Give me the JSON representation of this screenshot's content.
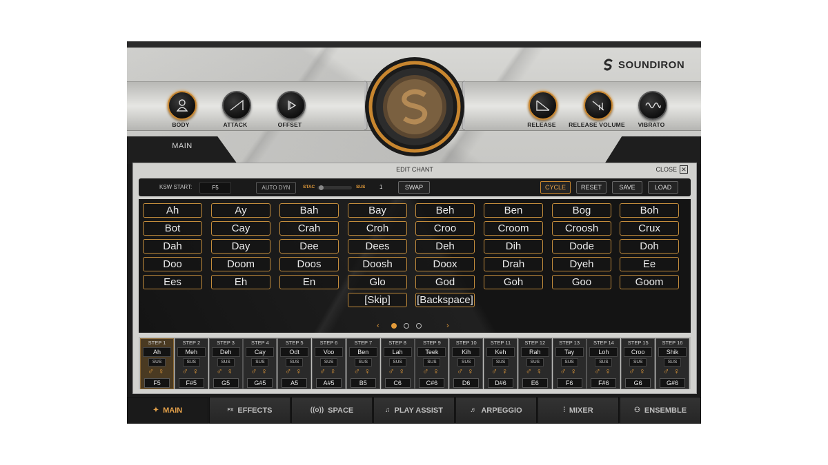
{
  "brand": {
    "name": "SOUNDIRON"
  },
  "knobs": [
    {
      "label": "BODY",
      "icon": "body-icon"
    },
    {
      "label": "ATTACK",
      "icon": "attack-ramp-icon"
    },
    {
      "label": "OFFSET",
      "icon": "offset-icon"
    },
    {
      "label": "RELEASE",
      "icon": "release-ramp-icon"
    },
    {
      "label": "RELEASE VOLUME",
      "icon": "release-volume-icon"
    },
    {
      "label": "VIBRATO",
      "icon": "vibrato-wave-icon"
    }
  ],
  "header": {
    "main_label": "MAIN"
  },
  "edit": {
    "title": "EDIT CHANT",
    "close_label": "CLOSE",
    "ksw_label": "KSW START:",
    "ksw_value": "F5",
    "auto_dyn": "AUTO DYN",
    "stac": "STAC",
    "sus": "SUS",
    "count": "1",
    "swap": "SWAP",
    "cycle": "CYCLE",
    "reset": "RESET",
    "save": "SAVE",
    "load": "LOAD"
  },
  "syllables": [
    [
      "Ah",
      "Ay",
      "Bah",
      "Bay",
      "Beh",
      "Ben",
      "Bog",
      "Boh"
    ],
    [
      "Bot",
      "Cay",
      "Crah",
      "Croh",
      "Croo",
      "Croom",
      "Croosh",
      "Crux"
    ],
    [
      "Dah",
      "Day",
      "Dee",
      "Dees",
      "Deh",
      "Dih",
      "Dode",
      "Doh"
    ],
    [
      "Doo",
      "Doom",
      "Doos",
      "Doosh",
      "Doox",
      "Drah",
      "Dyeh",
      "Ee"
    ],
    [
      "Ees",
      "Eh",
      "En",
      "Glo",
      "God",
      "Goh",
      "Goo",
      "Goom"
    ],
    [
      "",
      "",
      "",
      "[Skip]",
      "[Backspace]",
      "",
      "",
      ""
    ]
  ],
  "pager": {
    "prev": "‹",
    "next": "›",
    "pages": 3,
    "current": 1
  },
  "steps": [
    {
      "name": "STEP 1",
      "syl": "Ah",
      "sus": "SUS",
      "note": "F5"
    },
    {
      "name": "STEP 2",
      "syl": "Meh",
      "sus": "SUS",
      "note": "F#5"
    },
    {
      "name": "STEP 3",
      "syl": "Deh",
      "sus": "SUS",
      "note": "G5"
    },
    {
      "name": "STEP 4",
      "syl": "Cay",
      "sus": "SUS",
      "note": "G#5"
    },
    {
      "name": "STEP 5",
      "syl": "Odt",
      "sus": "SUS",
      "note": "A5"
    },
    {
      "name": "STEP 6",
      "syl": "Voo",
      "sus": "SUS",
      "note": "A#5"
    },
    {
      "name": "STEP 7",
      "syl": "Ben",
      "sus": "SUS",
      "note": "B5"
    },
    {
      "name": "STEP 8",
      "syl": "Lah",
      "sus": "SUS",
      "note": "C6"
    },
    {
      "name": "STEP 9",
      "syl": "Teek",
      "sus": "SUS",
      "note": "C#6"
    },
    {
      "name": "STEP 10",
      "syl": "Kih",
      "sus": "SUS",
      "note": "D6"
    },
    {
      "name": "STEP 11",
      "syl": "Keh",
      "sus": "SUS",
      "note": "D#6"
    },
    {
      "name": "STEP 12",
      "syl": "Rah",
      "sus": "SUS",
      "note": "E6"
    },
    {
      "name": "STEP 13",
      "syl": "Tay",
      "sus": "SUS",
      "note": "F6"
    },
    {
      "name": "STEP 14",
      "syl": "Loh",
      "sus": "SUS",
      "note": "F#6"
    },
    {
      "name": "STEP 15",
      "syl": "Croo",
      "sus": "SUS",
      "note": "G6"
    },
    {
      "name": "STEP 16",
      "syl": "Shik",
      "sus": "SUS",
      "note": "G#6"
    }
  ],
  "tabs": [
    {
      "label": "MAIN",
      "icon": "main-icon",
      "active": true
    },
    {
      "label": "EFFECTS",
      "icon": "fx-icon",
      "prefix": "FX"
    },
    {
      "label": "SPACE",
      "icon": "space-icon"
    },
    {
      "label": "PLAY ASSIST",
      "icon": "music-note-icon"
    },
    {
      "label": "ARPEGGIO",
      "icon": "arpeggio-icon"
    },
    {
      "label": "MIXER",
      "icon": "mixer-icon"
    },
    {
      "label": "ENSEMBLE",
      "icon": "ensemble-icon"
    }
  ],
  "colors": {
    "accent": "#e39b3a",
    "chip_border": "#c48d3c",
    "dark": "#141414"
  }
}
